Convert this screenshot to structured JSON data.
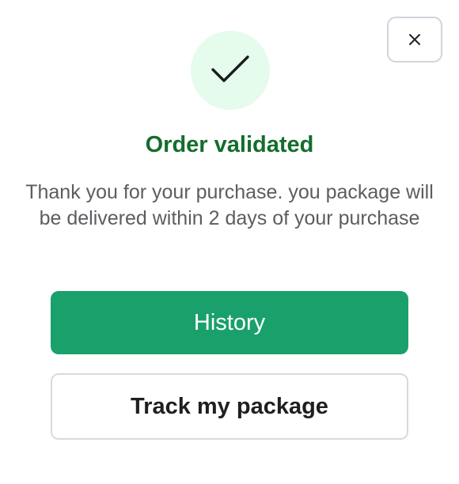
{
  "dialog": {
    "close_icon": "close-icon",
    "status_icon": "checkmark-icon",
    "title": "Order validated",
    "message": "Thank you for your purchase. you package will be delivered within 2 days of your purchase",
    "primary_button_label": "History",
    "secondary_button_label": "Track my package"
  },
  "colors": {
    "title": "#146d2c",
    "primary_button": "#1aa06b",
    "icon_circle": "#e5fbec",
    "message_text": "#5d5d61"
  }
}
